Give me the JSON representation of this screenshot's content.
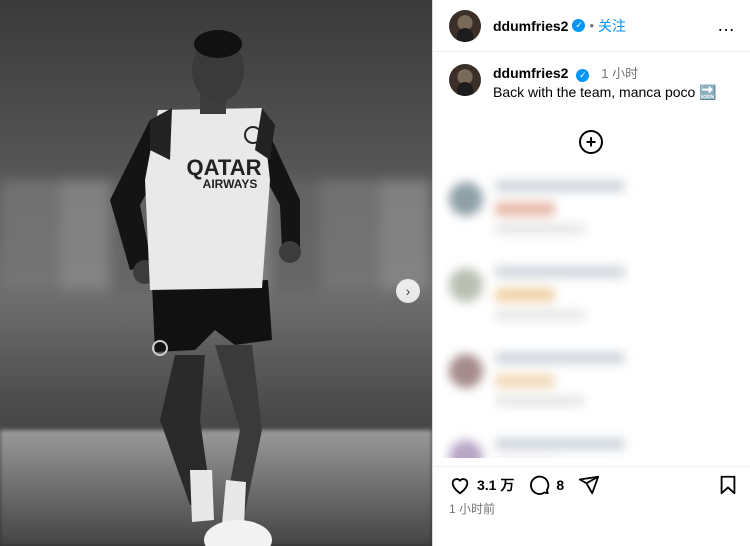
{
  "photo": {
    "jersey_text_1": "QATAR",
    "jersey_text_2": "AIRWAYS"
  },
  "post": {
    "username": "ddumfries2",
    "verified_mark": "✓",
    "separator": "•",
    "follow_label": "关注",
    "more_icon": "…",
    "caption": "Back with the team, manca poco 🔜",
    "caption_time": "1 小时",
    "add_comment_icon": "+",
    "likes": "3.1 万",
    "comments_count": "8",
    "posted_time": "1 小时前"
  },
  "colors": {
    "accent": "#0095f6",
    "muted": "#737373"
  },
  "icons": [
    "next-arrow-icon",
    "verified-icon",
    "more-icon",
    "add-comment-icon",
    "heart-icon",
    "comment-icon",
    "share-icon",
    "bookmark-icon"
  ]
}
